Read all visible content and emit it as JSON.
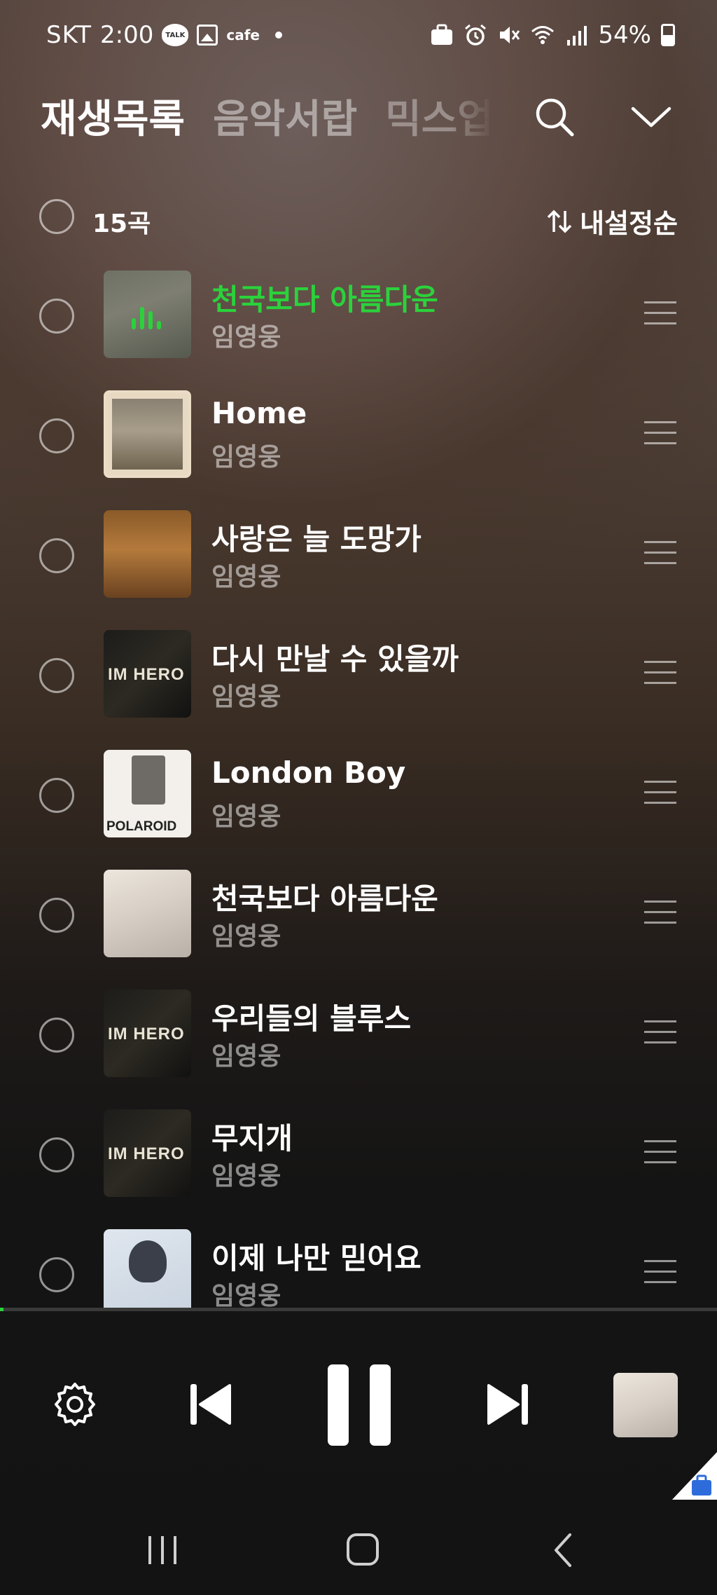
{
  "status_bar": {
    "carrier": "SKT",
    "time": "2:00",
    "talk_icon_label": "TALK",
    "cafe_label": "cafe",
    "battery": "54%"
  },
  "tabs": [
    {
      "label": "재생목록",
      "active": true
    },
    {
      "label": "음악서랍",
      "active": false
    },
    {
      "label": "믹스업",
      "active": false
    }
  ],
  "list_header": {
    "count": "15곡",
    "sort_label": "내설정순"
  },
  "songs": [
    {
      "title": "천국보다 아름다운",
      "artist": "임영웅",
      "playing": true
    },
    {
      "title": "Home",
      "artist": "임영웅",
      "playing": false
    },
    {
      "title": "사랑은 늘 도망가",
      "artist": "임영웅",
      "playing": false
    },
    {
      "title": "다시 만날 수 있을까",
      "artist": "임영웅",
      "playing": false
    },
    {
      "title": "London Boy",
      "artist": "임영웅",
      "playing": false,
      "art_text": "POLAROID"
    },
    {
      "title": "천국보다 아름다운",
      "artist": "임영웅",
      "playing": false
    },
    {
      "title": "우리들의 블루스",
      "artist": "임영웅",
      "playing": false
    },
    {
      "title": "무지개",
      "artist": "임영웅",
      "playing": false
    },
    {
      "title": "이제 나만 믿어요",
      "artist": "임영웅",
      "playing": false
    }
  ],
  "album_art_text": "IM HERO",
  "player": {
    "progress_fraction": 0.005
  },
  "colors": {
    "accent": "#2bd23b",
    "background": "#131313"
  },
  "icons": {
    "search": "search-icon",
    "collapse": "chevron-down-icon",
    "sort": "sort-arrows-icon",
    "settings": "gear-icon",
    "previous": "skip-previous-icon",
    "pause": "pause-icon",
    "next": "skip-next-icon"
  }
}
